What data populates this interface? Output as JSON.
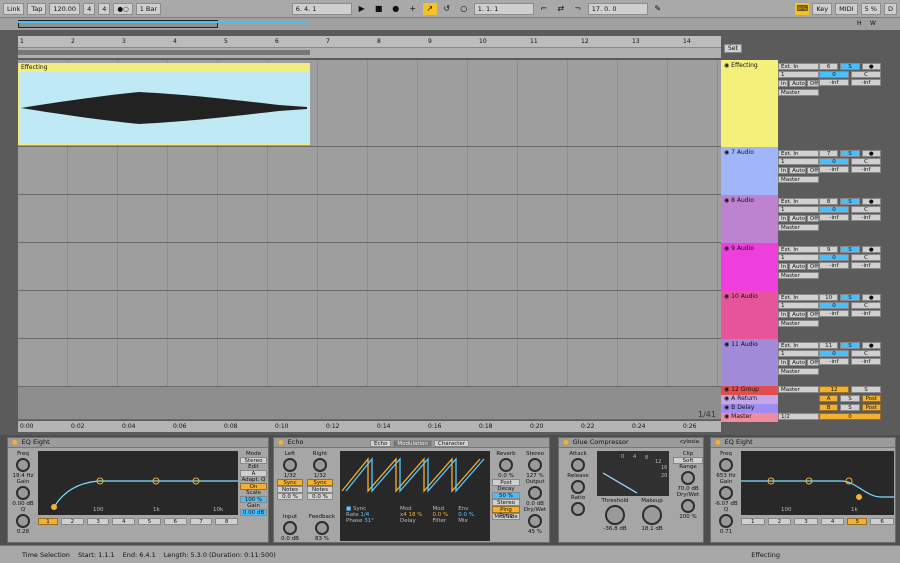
{
  "topbar": {
    "link": "Link",
    "tap": "Tap",
    "tempo": "120.00",
    "sig_num": "4",
    "sig_den": "4",
    "quant": "1 Bar",
    "position": "6.   4.   1",
    "loop_start": "1.   1.   1",
    "loop_len": "17.   0.   0",
    "key": "Key",
    "midi": "MIDI",
    "cpu": "5 %",
    "cpu_d": "D"
  },
  "ruler": {
    "bars": [
      "1",
      "2",
      "3",
      "4",
      "5",
      "6",
      "7",
      "8",
      "9",
      "10",
      "11",
      "12",
      "13",
      "14"
    ]
  },
  "timeaxis": {
    "labels": [
      "0:00",
      "0:02",
      "0:04",
      "0:06",
      "0:08",
      "0:10",
      "0:12",
      "0:14",
      "0:16",
      "0:18",
      "0:20",
      "0:22",
      "0:24",
      "0:26"
    ],
    "ratio": "1/41"
  },
  "set_btn": "Set",
  "clip": {
    "name": "Effecting"
  },
  "tracks": [
    {
      "name": "Effecting",
      "color": "#f4f07a",
      "input": "Ext. In",
      "ch": "1",
      "mon": [
        "In",
        "Auto",
        "Off"
      ],
      "out": "Master",
      "num": "6",
      "vol": "0",
      "pan": "C",
      "peak": "-inf",
      "peak2": "-inf",
      "s": "S"
    },
    {
      "name": "7 Audio",
      "color": "#a1b6fa",
      "input": "Ext. In",
      "ch": "1",
      "mon": [
        "In",
        "Auto",
        "Off"
      ],
      "out": "Master",
      "num": "7",
      "vol": "0",
      "pan": "C",
      "peak": "-inf",
      "peak2": "-inf",
      "s": "S"
    },
    {
      "name": "8 Audio",
      "color": "#bd83d1",
      "input": "Ext. In",
      "ch": "1",
      "mon": [
        "In",
        "Auto",
        "Off"
      ],
      "out": "Master",
      "num": "8",
      "vol": "0",
      "pan": "C",
      "peak": "-inf",
      "peak2": "-inf",
      "s": "S"
    },
    {
      "name": "9 Audio",
      "color": "#ee3edc",
      "input": "Ext. In",
      "ch": "1",
      "mon": [
        "In",
        "Auto",
        "Off"
      ],
      "out": "Master",
      "num": "9",
      "vol": "0",
      "pan": "C",
      "peak": "-inf",
      "peak2": "-inf",
      "s": "S"
    },
    {
      "name": "10 Audio",
      "color": "#e6559b",
      "input": "Ext. In",
      "ch": "1",
      "mon": [
        "In",
        "Auto",
        "Off"
      ],
      "out": "Master",
      "num": "10",
      "vol": "0",
      "pan": "C",
      "peak": "-inf",
      "peak2": "-inf",
      "s": "S"
    },
    {
      "name": "11 Audio",
      "color": "#a18ad8",
      "input": "Ext. In",
      "ch": "1",
      "mon": [
        "In",
        "Auto",
        "Off"
      ],
      "out": "Master",
      "num": "11",
      "vol": "0",
      "pan": "C",
      "peak": "-inf",
      "peak2": "-inf",
      "s": "S"
    }
  ],
  "small_tracks": [
    {
      "name": "12 Group",
      "color": "#e14e4e",
      "out": "Master",
      "num": "12",
      "s": "S"
    },
    {
      "name": "A Return",
      "color": "#c4a7e8",
      "num": "A",
      "s": "S",
      "post": "Post"
    },
    {
      "name": "B Delay",
      "color": "#a08cf0",
      "num": "B",
      "s": "S",
      "post": "Post"
    },
    {
      "name": "Master",
      "color": "#f08ca0",
      "out": "1/2",
      "num": "0"
    }
  ],
  "eq1": {
    "title": "EQ Eight",
    "freq_l": "Freq",
    "freq": "19.4 Hz",
    "gain_l": "Gain",
    "gain": "0.00 dB",
    "q_l": "Q",
    "q": "0.28",
    "mode_l": "Mode",
    "mode": "Stereo",
    "edit_l": "Edit",
    "edit": "A",
    "adapt_l": "Adapt. Q",
    "adapt": "On",
    "scale_l": "Scale",
    "scale": "100 %",
    "gain2_l": "Gain",
    "gain2": "0.00 dB",
    "axis": [
      "100",
      "1k",
      "10k"
    ],
    "bands": [
      "1",
      "2",
      "3",
      "4",
      "5",
      "6",
      "7",
      "8"
    ]
  },
  "echo": {
    "title": "Echo",
    "left_l": "Left",
    "left": "1/32",
    "right_l": "Right",
    "right": "1/32",
    "sync": "Sync",
    "notes": "Notes",
    "pct": "0.0 %",
    "input_l": "Input",
    "input": "0.0 dB",
    "fb_l": "Feedback",
    "fb": "83 %",
    "tabs": [
      "Echo",
      "Modulation",
      "Character"
    ],
    "sync_l": "Sync",
    "rate_l": "Rate",
    "rate": "1/4",
    "phase_l": "Phase",
    "phase": "31°",
    "x4": "x4",
    "mod_l": "Mod",
    "mod": "18 %",
    "mod2_l": "Mod",
    "mod2": "0.0 %",
    "env_l": "Env",
    "env": "0.0 %",
    "delay_l": "Delay",
    "filter_l": "Filter",
    "mix_l": "Mix",
    "reverb_l": "Reverb",
    "reverb": "0.0 %",
    "post": "Post",
    "decay_l": "Decay",
    "decay": "50 %",
    "stereo_l": "Stereo",
    "stereo": "127 %",
    "output_l": "Output",
    "output": "0.0 dB",
    "stereo_btn": "Stereo",
    "ping": "Ping Pong",
    "midside": "Mid/Side",
    "drywet_l": "Dry/Wet",
    "drywet": "45 %"
  },
  "glue": {
    "title": "Glue Compressor",
    "preset": "cylosia",
    "attack_l": "Attack",
    "release_l": "Release",
    "ratio_l": "Ratio",
    "threshold_l": "Threshold",
    "threshold": "-36.8 dB",
    "makeup_l": "Makeup",
    "makeup": "18.1 dB",
    "clip_l": "Clip",
    "soft": "Soft",
    "range_l": "Range",
    "range": "70.0 dB",
    "drywet_l": "Dry/Wet",
    "drywet": "100 %",
    "meter": [
      "0",
      "4",
      "8",
      "12",
      "16",
      "20"
    ]
  },
  "eq2": {
    "title": "EQ Eight",
    "freq_l": "Freq",
    "freq": "653 Hz",
    "gain_l": "Gain",
    "gain": "-6.07 dB",
    "q_l": "Q",
    "q": "0.71",
    "axis": [
      "100",
      "1k"
    ],
    "bands": [
      "1",
      "2",
      "3",
      "4",
      "5",
      "6"
    ]
  },
  "status": {
    "label": "Time Selection",
    "start": "Start: 1.1.1",
    "end": "End: 6.4.1",
    "length": "Length: 5.3.0  (Duration: 0:11:500)",
    "track": "Effecting"
  },
  "colors": {
    "accent": "#f4c227",
    "clip": "#bfe9f5",
    "blue": "#47bfff"
  }
}
